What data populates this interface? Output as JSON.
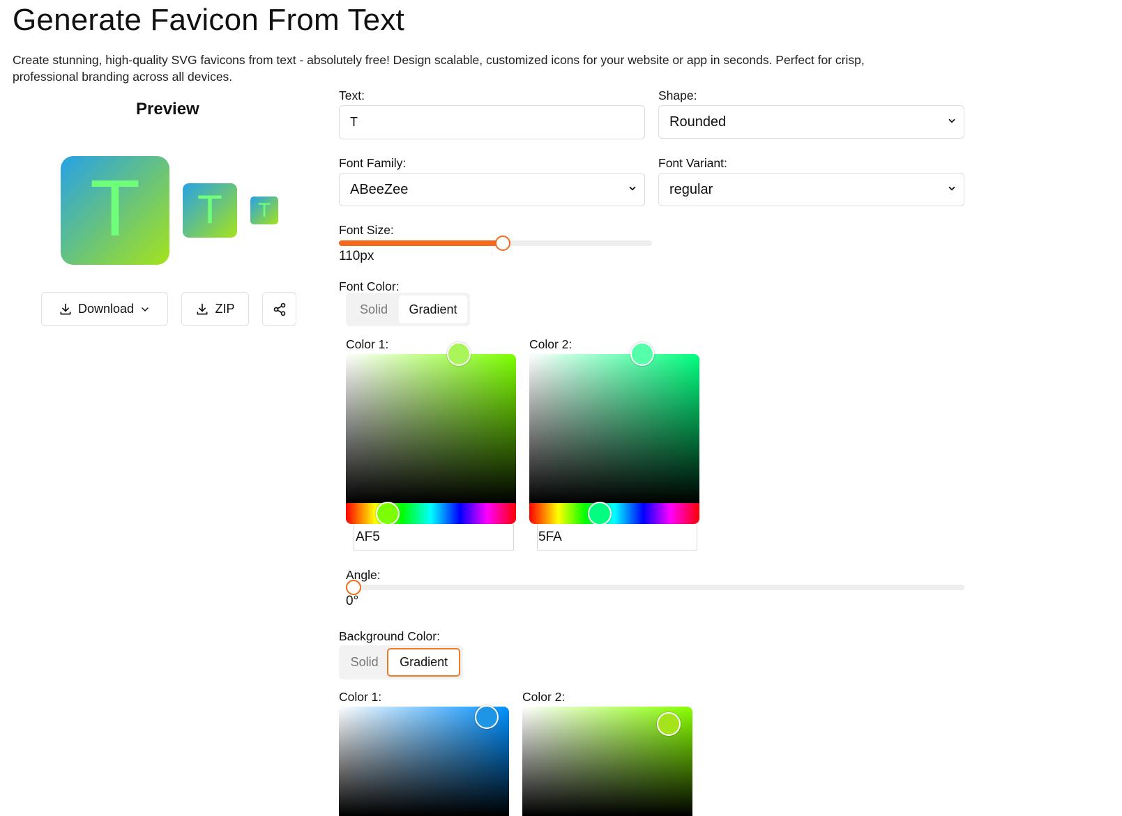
{
  "header": {
    "title": "Generate Favicon From Text",
    "description": "Create stunning, high-quality SVG favicons from text - absolutely free! Design scalable, customized icons for your website or app in seconds. Perfect for crisp, professional branding across all devices."
  },
  "preview": {
    "heading": "Preview",
    "letter": "T",
    "gradient_colors": [
      "#27a1e6",
      "#a5e31b"
    ],
    "text_color": "#6fff7a"
  },
  "actions": {
    "download_label": "Download",
    "zip_label": "ZIP"
  },
  "form": {
    "text": {
      "label": "Text:",
      "value": "T"
    },
    "shape": {
      "label": "Shape:",
      "value": "Rounded"
    },
    "font_family": {
      "label": "Font Family:",
      "value": "ABeeZee"
    },
    "font_variant": {
      "label": "Font Variant:",
      "value": "regular"
    },
    "font_size": {
      "label": "Font Size:",
      "value": "110px",
      "slider_fraction": 0.52
    },
    "font_color": {
      "label": "Font Color:",
      "options": [
        "Solid",
        "Gradient"
      ],
      "selected": "Gradient",
      "color1": {
        "label": "Color 1:",
        "hex": "AF5",
        "swatch": "#aaf55a"
      },
      "color2": {
        "label": "Color 2:",
        "hex": "5FA",
        "swatch": "#55ffaa"
      }
    },
    "angle": {
      "label": "Angle:",
      "value": "0°"
    },
    "background_color": {
      "label": "Background Color:",
      "options": [
        "Solid",
        "Gradient"
      ],
      "selected": "Gradient",
      "color1": {
        "label": "Color 1:",
        "swatch": "#1f95e6"
      },
      "color2": {
        "label": "Color 2:",
        "swatch": "#a5e31b"
      }
    }
  },
  "colors": {
    "accent": "#f26a1b",
    "border": "#dcdcdc"
  }
}
